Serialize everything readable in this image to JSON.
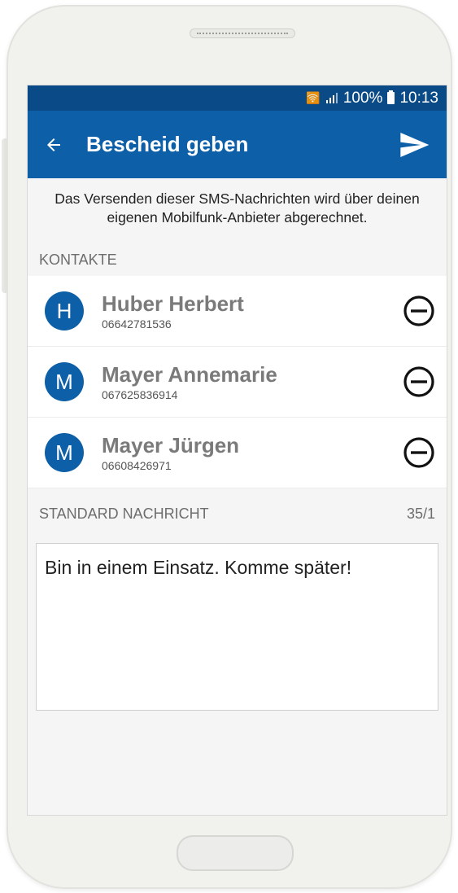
{
  "status_bar": {
    "battery": "100%",
    "time": "10:13"
  },
  "app_bar": {
    "title": "Bescheid geben"
  },
  "notice": "Das Versenden dieser SMS-Nachrichten wird über deinen eigenen Mobilfunk-Anbieter abgerechnet.",
  "contacts_section": {
    "label": "KONTAKTE"
  },
  "contacts": [
    {
      "initial": "H",
      "name": "Huber Herbert",
      "phone": "06642781536"
    },
    {
      "initial": "M",
      "name": "Mayer Annemarie",
      "phone": "067625836914"
    },
    {
      "initial": "M",
      "name": "Mayer Jürgen",
      "phone": "06608426971"
    }
  ],
  "message_section": {
    "label": "STANDARD NACHRICHT",
    "counter": "35/1"
  },
  "message": {
    "text": "Bin in einem Einsatz. Komme später!"
  },
  "colors": {
    "primary": "#0d5fa8",
    "status_bar": "#0a4a86"
  },
  "icons": {
    "back": "arrow-left-icon",
    "send": "send-icon",
    "remove": "minus-circle-icon"
  }
}
